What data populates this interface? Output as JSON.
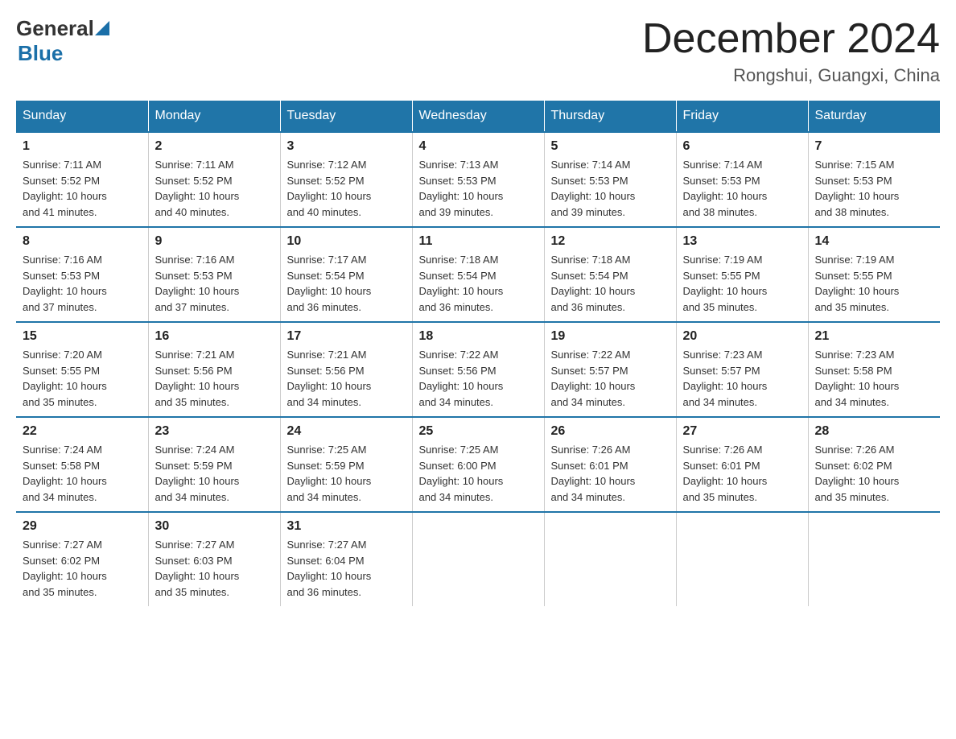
{
  "header": {
    "title": "December 2024",
    "subtitle": "Rongshui, Guangxi, China",
    "logo_general": "General",
    "logo_blue": "Blue"
  },
  "days_of_week": [
    "Sunday",
    "Monday",
    "Tuesday",
    "Wednesday",
    "Thursday",
    "Friday",
    "Saturday"
  ],
  "weeks": [
    [
      {
        "day": "1",
        "sunrise": "7:11 AM",
        "sunset": "5:52 PM",
        "daylight": "10 hours and 41 minutes."
      },
      {
        "day": "2",
        "sunrise": "7:11 AM",
        "sunset": "5:52 PM",
        "daylight": "10 hours and 40 minutes."
      },
      {
        "day": "3",
        "sunrise": "7:12 AM",
        "sunset": "5:52 PM",
        "daylight": "10 hours and 40 minutes."
      },
      {
        "day": "4",
        "sunrise": "7:13 AM",
        "sunset": "5:53 PM",
        "daylight": "10 hours and 39 minutes."
      },
      {
        "day": "5",
        "sunrise": "7:14 AM",
        "sunset": "5:53 PM",
        "daylight": "10 hours and 39 minutes."
      },
      {
        "day": "6",
        "sunrise": "7:14 AM",
        "sunset": "5:53 PM",
        "daylight": "10 hours and 38 minutes."
      },
      {
        "day": "7",
        "sunrise": "7:15 AM",
        "sunset": "5:53 PM",
        "daylight": "10 hours and 38 minutes."
      }
    ],
    [
      {
        "day": "8",
        "sunrise": "7:16 AM",
        "sunset": "5:53 PM",
        "daylight": "10 hours and 37 minutes."
      },
      {
        "day": "9",
        "sunrise": "7:16 AM",
        "sunset": "5:53 PM",
        "daylight": "10 hours and 37 minutes."
      },
      {
        "day": "10",
        "sunrise": "7:17 AM",
        "sunset": "5:54 PM",
        "daylight": "10 hours and 36 minutes."
      },
      {
        "day": "11",
        "sunrise": "7:18 AM",
        "sunset": "5:54 PM",
        "daylight": "10 hours and 36 minutes."
      },
      {
        "day": "12",
        "sunrise": "7:18 AM",
        "sunset": "5:54 PM",
        "daylight": "10 hours and 36 minutes."
      },
      {
        "day": "13",
        "sunrise": "7:19 AM",
        "sunset": "5:55 PM",
        "daylight": "10 hours and 35 minutes."
      },
      {
        "day": "14",
        "sunrise": "7:19 AM",
        "sunset": "5:55 PM",
        "daylight": "10 hours and 35 minutes."
      }
    ],
    [
      {
        "day": "15",
        "sunrise": "7:20 AM",
        "sunset": "5:55 PM",
        "daylight": "10 hours and 35 minutes."
      },
      {
        "day": "16",
        "sunrise": "7:21 AM",
        "sunset": "5:56 PM",
        "daylight": "10 hours and 35 minutes."
      },
      {
        "day": "17",
        "sunrise": "7:21 AM",
        "sunset": "5:56 PM",
        "daylight": "10 hours and 34 minutes."
      },
      {
        "day": "18",
        "sunrise": "7:22 AM",
        "sunset": "5:56 PM",
        "daylight": "10 hours and 34 minutes."
      },
      {
        "day": "19",
        "sunrise": "7:22 AM",
        "sunset": "5:57 PM",
        "daylight": "10 hours and 34 minutes."
      },
      {
        "day": "20",
        "sunrise": "7:23 AM",
        "sunset": "5:57 PM",
        "daylight": "10 hours and 34 minutes."
      },
      {
        "day": "21",
        "sunrise": "7:23 AM",
        "sunset": "5:58 PM",
        "daylight": "10 hours and 34 minutes."
      }
    ],
    [
      {
        "day": "22",
        "sunrise": "7:24 AM",
        "sunset": "5:58 PM",
        "daylight": "10 hours and 34 minutes."
      },
      {
        "day": "23",
        "sunrise": "7:24 AM",
        "sunset": "5:59 PM",
        "daylight": "10 hours and 34 minutes."
      },
      {
        "day": "24",
        "sunrise": "7:25 AM",
        "sunset": "5:59 PM",
        "daylight": "10 hours and 34 minutes."
      },
      {
        "day": "25",
        "sunrise": "7:25 AM",
        "sunset": "6:00 PM",
        "daylight": "10 hours and 34 minutes."
      },
      {
        "day": "26",
        "sunrise": "7:26 AM",
        "sunset": "6:01 PM",
        "daylight": "10 hours and 34 minutes."
      },
      {
        "day": "27",
        "sunrise": "7:26 AM",
        "sunset": "6:01 PM",
        "daylight": "10 hours and 35 minutes."
      },
      {
        "day": "28",
        "sunrise": "7:26 AM",
        "sunset": "6:02 PM",
        "daylight": "10 hours and 35 minutes."
      }
    ],
    [
      {
        "day": "29",
        "sunrise": "7:27 AM",
        "sunset": "6:02 PM",
        "daylight": "10 hours and 35 minutes."
      },
      {
        "day": "30",
        "sunrise": "7:27 AM",
        "sunset": "6:03 PM",
        "daylight": "10 hours and 35 minutes."
      },
      {
        "day": "31",
        "sunrise": "7:27 AM",
        "sunset": "6:04 PM",
        "daylight": "10 hours and 36 minutes."
      },
      null,
      null,
      null,
      null
    ]
  ],
  "labels": {
    "sunrise": "Sunrise:",
    "sunset": "Sunset:",
    "daylight": "Daylight:"
  },
  "colors": {
    "header_bg": "#2075a8",
    "border": "#2075a8",
    "logo_blue": "#1a6fa8"
  }
}
